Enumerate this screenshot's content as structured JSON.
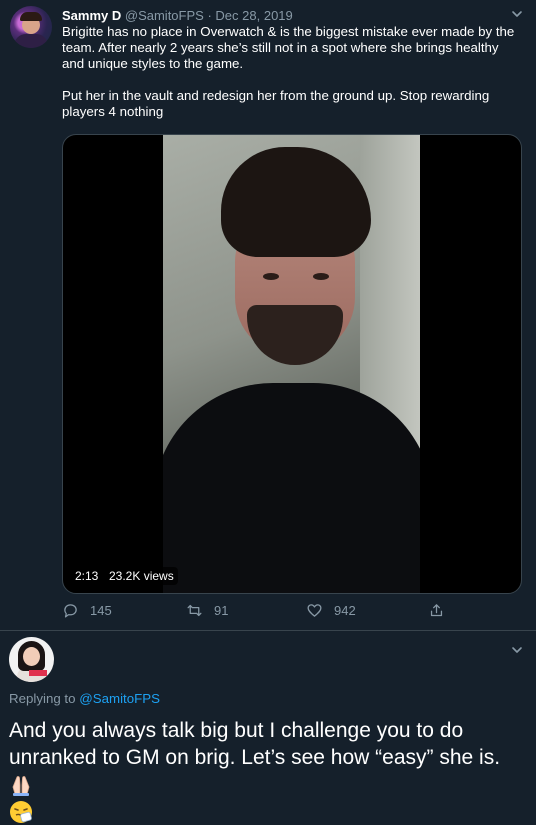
{
  "tweet": {
    "author_name": "Sammy D",
    "author_handle": "@SamitoFPS",
    "separator": "·",
    "date": "Dec 28, 2019",
    "paragraph_1": "Brigitte has no place in Overwatch & is the biggest mistake ever made by the team. After nearly 2 years she’s still not in a spot where she brings healthy and unique styles to the game.",
    "paragraph_2": "Put her in the vault and redesign her from the ground up. Stop rewarding players 4 nothing",
    "video": {
      "duration": "2:13",
      "views": "23.2K views"
    },
    "stats": {
      "replies": "145",
      "retweets": "91",
      "likes": "942"
    }
  },
  "reply": {
    "replying_to_prefix": "Replying to",
    "replying_to_handle": "@SamitoFPS",
    "text": "And you always talk big but I challenge you to do unranked to GM on brig. Let’s see how “easy” she is.",
    "emojis": [
      "folded-hands",
      "sneezing-face"
    ]
  },
  "colors": {
    "background": "#15202b",
    "muted": "#8899a6",
    "link": "#1da1f2",
    "divider": "#38444d"
  }
}
